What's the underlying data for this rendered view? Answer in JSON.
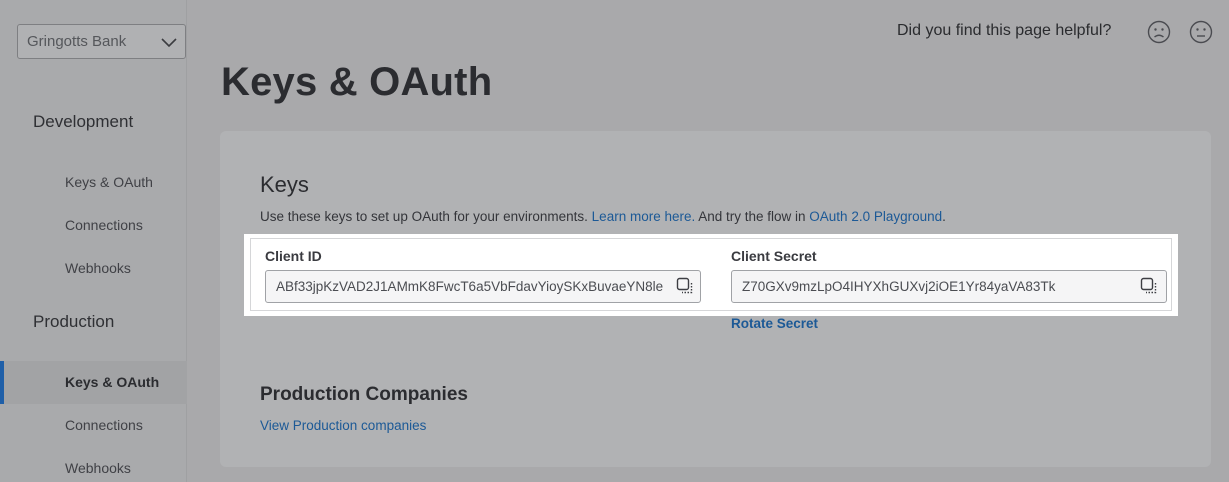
{
  "sidebar": {
    "company": "Gringotts Bank",
    "sections": [
      {
        "title": "Development",
        "items": [
          "Keys & OAuth",
          "Connections",
          "Webhooks"
        ]
      },
      {
        "title": "Production",
        "items": [
          "Keys & OAuth",
          "Connections",
          "Webhooks"
        ]
      }
    ],
    "active_item": "Keys & OAuth"
  },
  "header": {
    "helpful_prompt": "Did you find this page helpful?",
    "icons": [
      "sad-face-icon",
      "neutral-face-icon"
    ]
  },
  "page_title": "Keys & OAuth",
  "keys": {
    "title": "Keys",
    "desc_prefix": "Use these keys to set up OAuth for your environments. ",
    "learn_more": "Learn more here.",
    "desc_middle": " And try the flow in ",
    "playground_link": "OAuth 2.0 Playground",
    "desc_suffix": ".",
    "client_id_label": "Client ID",
    "client_id_value": "ABf33jpKzVAD2J1AMmK8FwcT6a5VbFdavYioySKxBuvaeYN8le",
    "client_secret_label": "Client Secret",
    "client_secret_value": "Z70GXv9mzLpO4IHYXhGUXvj2iOE1Yr84yaVA83Tk",
    "rotate_secret": "Rotate Secret"
  },
  "production_companies": {
    "title": "Production Companies",
    "link": "View Production companies"
  },
  "colors": {
    "link": "#1c5996",
    "active_indicator": "#1f5fa8",
    "overlay_bg": "#a9a9ab",
    "highlight_bg": "#ffffff"
  }
}
